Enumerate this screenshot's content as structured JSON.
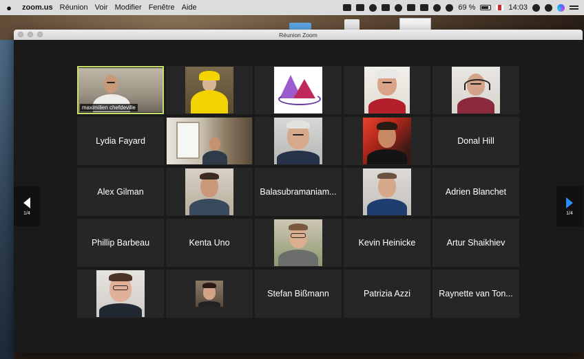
{
  "menubar": {
    "app": "zoom.us",
    "menus": [
      "Réunion",
      "Voir",
      "Modifier",
      "Fenêtre",
      "Aide"
    ],
    "battery": "69 %",
    "time": "14:03"
  },
  "window": {
    "title": "Réunion Zoom"
  },
  "pager": {
    "left_label": "1/4",
    "right_label": "1/4"
  },
  "participants": [
    {
      "type": "video",
      "tag": "maximilien chefdeville",
      "active": true
    },
    {
      "type": "video"
    },
    {
      "type": "video"
    },
    {
      "type": "video"
    },
    {
      "type": "video"
    },
    {
      "type": "name",
      "name": "Lydia Fayard"
    },
    {
      "type": "video"
    },
    {
      "type": "video"
    },
    {
      "type": "video"
    },
    {
      "type": "name",
      "name": "Donal Hill"
    },
    {
      "type": "name",
      "name": "Alex Gilman"
    },
    {
      "type": "video"
    },
    {
      "type": "name",
      "name": "Balasubramaniam..."
    },
    {
      "type": "video"
    },
    {
      "type": "name",
      "name": "Adrien Blanchet"
    },
    {
      "type": "name",
      "name": "Phillip Barbeau"
    },
    {
      "type": "name",
      "name": "Kenta Uno"
    },
    {
      "type": "video"
    },
    {
      "type": "name",
      "name": "Kevin Heinicke"
    },
    {
      "type": "name",
      "name": "Artur Shaikhiev"
    },
    {
      "type": "video"
    },
    {
      "type": "video"
    },
    {
      "type": "name",
      "name": "Stefan Bißmann"
    },
    {
      "type": "name",
      "name": "Patrizia Azzi"
    },
    {
      "type": "name",
      "name": "Raynette van Ton..."
    }
  ],
  "colors": {
    "active_border": "#c8e06a",
    "next_arrow": "#2d8cff",
    "tile_bg": "#262626"
  }
}
